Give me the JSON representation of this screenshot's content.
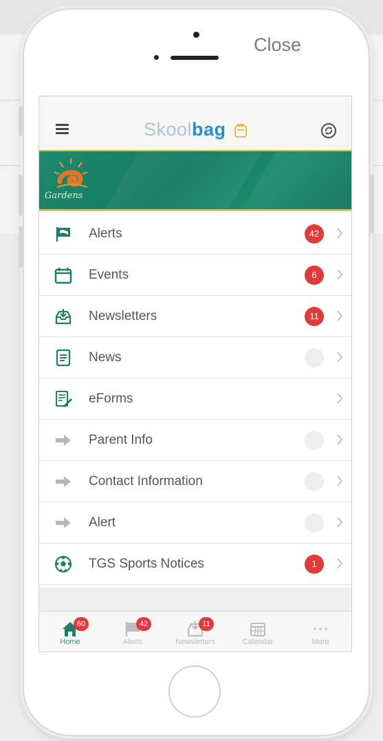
{
  "close_label": "Close",
  "app": {
    "logo_part1": "Skool",
    "logo_part2": "bag",
    "school_name": "Gardens",
    "brand_colors": {
      "accent": "#2b8fc7",
      "green": "#137a60",
      "badge": "#e03a3a"
    }
  },
  "menu": [
    {
      "label": "Alerts",
      "icon": "flag-icon",
      "badge": "42"
    },
    {
      "label": "Events",
      "icon": "calendar-icon",
      "badge": "6"
    },
    {
      "label": "Newsletters",
      "icon": "inbox-download-icon",
      "badge": "11"
    },
    {
      "label": "News",
      "icon": "document-icon",
      "badge": ""
    },
    {
      "label": "eForms",
      "icon": "form-edit-icon",
      "badge": null
    },
    {
      "label": "Parent Info",
      "icon": "arrow-right-icon",
      "badge": ""
    },
    {
      "label": "Contact Information",
      "icon": "arrow-right-icon",
      "badge": ""
    },
    {
      "label": "Alert",
      "icon": "arrow-right-icon",
      "badge": ""
    },
    {
      "label": "TGS Sports Notices",
      "icon": "soccer-ball-icon",
      "badge": "1"
    }
  ],
  "tabs": [
    {
      "label": "Home",
      "icon": "home-icon",
      "badge": "60",
      "active": true
    },
    {
      "label": "Alerts",
      "icon": "flag-icon",
      "badge": "42",
      "active": false
    },
    {
      "label": "Newsletters",
      "icon": "inbox-download-icon",
      "badge": "11",
      "active": false
    },
    {
      "label": "Calendar",
      "icon": "calendar-grid-icon",
      "badge": null,
      "active": false
    },
    {
      "label": "More",
      "icon": "more-dots-icon",
      "badge": null,
      "active": false
    }
  ]
}
